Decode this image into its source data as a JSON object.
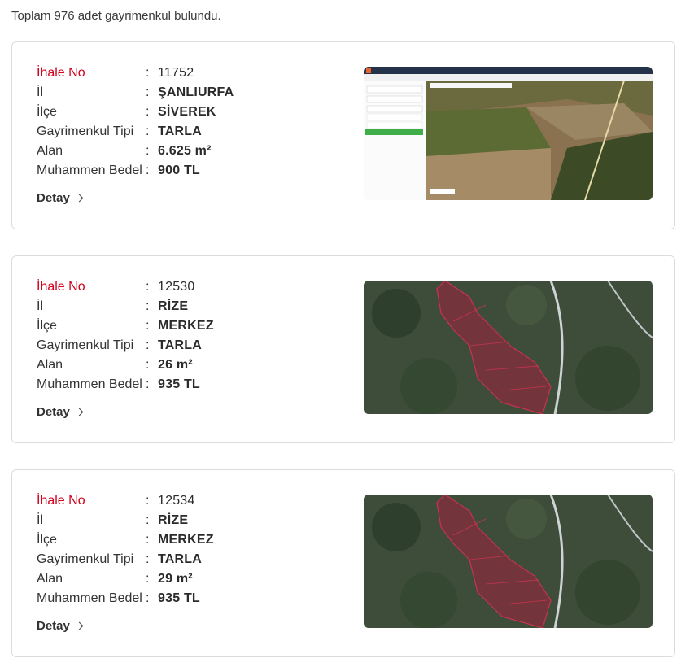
{
  "summary": "Toplam 976 adet gayrimenkul bulundu.",
  "labels": {
    "ihale_no": "İhale No",
    "il": "İl",
    "ilce": "İlçe",
    "tip": "Gayrimenkul Tipi",
    "alan": "Alan",
    "bedel": "Muhammen Bedel",
    "colon": ":",
    "detay": "Detay"
  },
  "listings": [
    {
      "ihale_no": "11752",
      "il": "ŞANLIURFA",
      "ilce": "SİVEREK",
      "tip": "TARLA",
      "alan": "6.625 m²",
      "bedel": "900 TL",
      "thumb": "satellite-field-map"
    },
    {
      "ihale_no": "12530",
      "il": "RİZE",
      "ilce": "MERKEZ",
      "tip": "TARLA",
      "alan": "26 m²",
      "bedel": "935 TL",
      "thumb": "parcel-map"
    },
    {
      "ihale_no": "12534",
      "il": "RİZE",
      "ilce": "MERKEZ",
      "tip": "TARLA",
      "alan": "29 m²",
      "bedel": "935 TL",
      "thumb": "parcel-map"
    }
  ],
  "colors": {
    "accent": "#d0021b",
    "border": "#dcdcdc"
  }
}
